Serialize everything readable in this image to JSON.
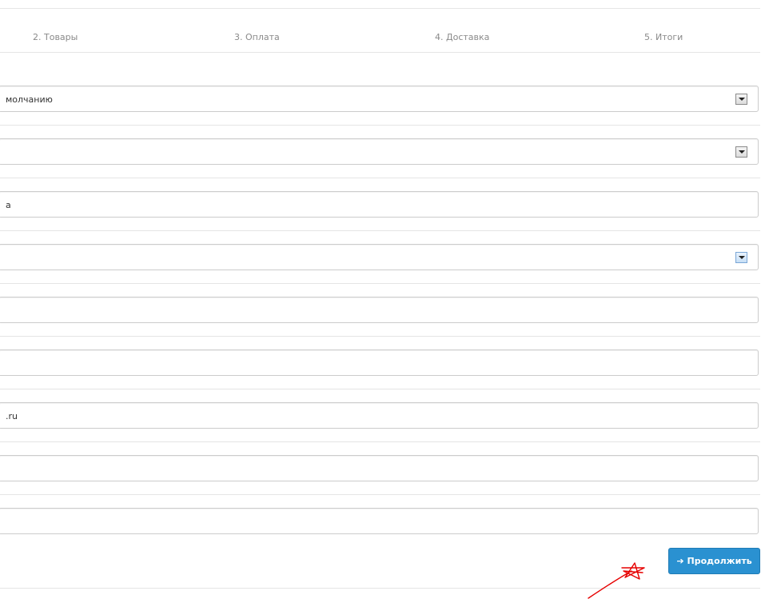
{
  "steps": [
    {
      "label": "2. Товары"
    },
    {
      "label": "3. Оплата"
    },
    {
      "label": "4. Доставка"
    },
    {
      "label": "5. Итоги"
    }
  ],
  "fields": [
    {
      "type": "select",
      "value": "молчанию"
    },
    {
      "type": "select",
      "value": ""
    },
    {
      "type": "text",
      "value": "а"
    },
    {
      "type": "select",
      "value": ""
    },
    {
      "type": "text",
      "value": ""
    },
    {
      "type": "text",
      "value": ""
    },
    {
      "type": "text",
      "value": ".ru"
    },
    {
      "type": "text",
      "value": ""
    },
    {
      "type": "text",
      "value": ""
    }
  ],
  "continue_button": {
    "label": "Продолжить",
    "icon": "arrow-right-icon"
  },
  "colors": {
    "button_bg": "#2a91d1",
    "annotation": "#e60000"
  }
}
